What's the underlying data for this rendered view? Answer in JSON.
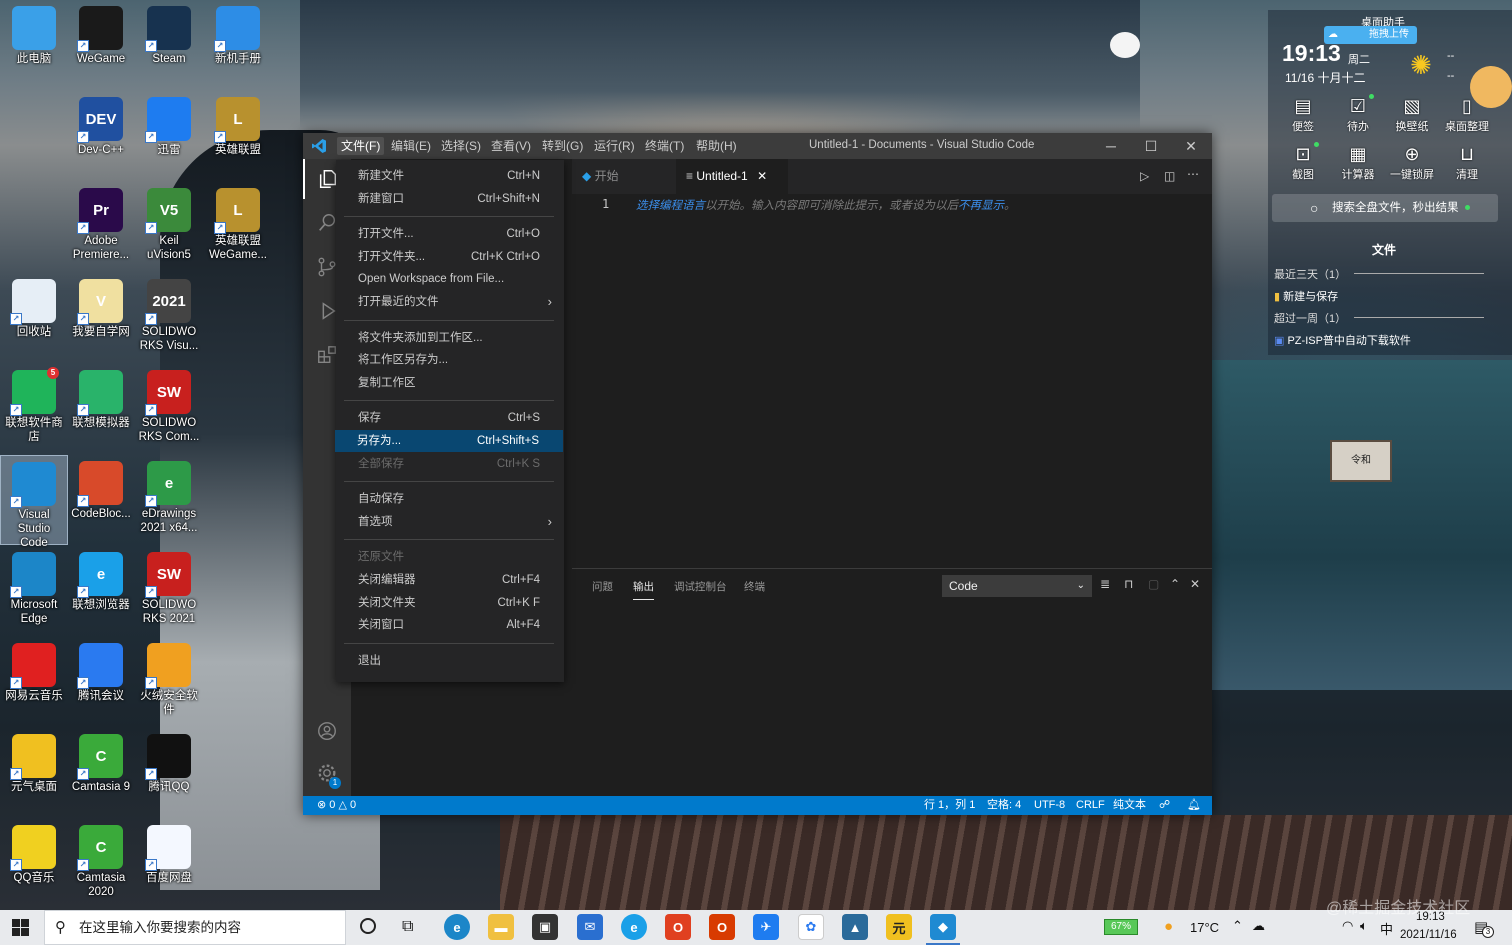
{
  "desktop": {
    "icons": [
      {
        "label": "此电脑",
        "icon": "computer-icon",
        "color": "#3aa0e8"
      },
      {
        "label": "WeGame",
        "icon": "wegame-icon",
        "color": "#1a1a1a"
      },
      {
        "label": "Steam",
        "icon": "steam-icon",
        "color": "#17324f"
      },
      {
        "label": "新机手册",
        "icon": "manual-icon",
        "color": "#2d8de6"
      },
      {
        "label": "Dev-C++",
        "icon": "devcpp-icon",
        "color": "#2050a0",
        "glyph": "DEV"
      },
      {
        "label": "迅雷",
        "icon": "xunlei-icon",
        "color": "#1e7cf0"
      },
      {
        "label": "英雄联盟",
        "icon": "lol-icon",
        "color": "#b8912e",
        "glyph": "L"
      },
      {
        "label": "Adobe\nPremiere...",
        "icon": "premiere-icon",
        "color": "#2a0a4a",
        "glyph": "Pr"
      },
      {
        "label": "Keil\nuVision5",
        "icon": "keil-icon",
        "color": "#3b8a3b",
        "glyph": "V5"
      },
      {
        "label": "英雄联盟\nWeGame...",
        "icon": "lol-wegame-icon",
        "color": "#b8912e",
        "glyph": "L"
      },
      {
        "label": "回收站",
        "icon": "recycle-bin-icon",
        "color": "#e6eef6"
      },
      {
        "label": "我要自学网",
        "icon": "zixue-icon",
        "color": "#f0e0a0",
        "glyph": "V"
      },
      {
        "label": "SOLIDWO\nRKS Visu...",
        "icon": "solidworks-visualize-icon",
        "color": "#444444",
        "glyph": "2021"
      },
      {
        "label": "联想软件商\n店",
        "icon": "lenovo-store-icon",
        "color": "#1fb45a"
      },
      {
        "label": "联想模拟器",
        "icon": "lenovo-emulator-icon",
        "color": "#29b36a"
      },
      {
        "label": "SOLIDWO\nRKS Com...",
        "icon": "solidworks-composer-icon",
        "color": "#c8201e",
        "glyph": "SW"
      },
      {
        "label": "Visual\nStudio\nCode",
        "icon": "vscode-icon",
        "color": "#1f8ad2"
      },
      {
        "label": "CodeBloc...",
        "icon": "codeblocks-icon",
        "color": "#d84a2a"
      },
      {
        "label": "eDrawings\n2021 x64...",
        "icon": "edrawings-icon",
        "color": "#2d9a48",
        "glyph": "e"
      },
      {
        "label": "Microsoft\nEdge",
        "icon": "edge-icon",
        "color": "#1c86c8"
      },
      {
        "label": "联想浏览器",
        "icon": "lenovo-browser-icon",
        "color": "#1aa0e8",
        "glyph": "e"
      },
      {
        "label": "SOLIDWO\nRKS 2021",
        "icon": "solidworks-icon",
        "color": "#c8201e",
        "glyph": "SW"
      },
      {
        "label": "网易云音乐",
        "icon": "netease-music-icon",
        "color": "#e02020"
      },
      {
        "label": "腾讯会议",
        "icon": "tencent-meeting-icon",
        "color": "#2a7af0"
      },
      {
        "label": "火绒安全软\n件",
        "icon": "huorong-icon",
        "color": "#f0a020"
      },
      {
        "label": "元气桌面",
        "icon": "yuanqi-icon",
        "color": "#f0c020"
      },
      {
        "label": "Camtasia 9",
        "icon": "camtasia9-icon",
        "color": "#3aaa3a",
        "glyph": "C"
      },
      {
        "label": "腾讯QQ",
        "icon": "qq-icon",
        "color": "#111111"
      },
      {
        "label": "QQ音乐",
        "icon": "qqmusic-icon",
        "color": "#f0d020"
      },
      {
        "label": "Camtasia\n2020",
        "icon": "camtasia2020-icon",
        "color": "#3aaa3a",
        "glyph": "C"
      },
      {
        "label": "百度网盘",
        "icon": "baidu-netdisk-icon",
        "color": "#f4f8ff"
      }
    ],
    "badge_count": "5",
    "sign_text": "令和"
  },
  "vscode": {
    "window_title": "Untitled-1 - Documents - Visual Studio Code",
    "menubar": [
      "文件(F)",
      "编辑(E)",
      "选择(S)",
      "查看(V)",
      "转到(G)",
      "运行(R)",
      "终端(T)",
      "帮助(H)"
    ],
    "tabs": [
      {
        "label": "开始",
        "active": false
      },
      {
        "label": "Untitled-1",
        "active": true
      }
    ],
    "editor": {
      "line_number": "1",
      "hint_link1": "选择编程语言",
      "hint_mid": "以开始。输入内容即可消除此提示，或者设为以后",
      "hint_link2": "不再显示",
      "hint_end": "。"
    },
    "panel": {
      "tabs": [
        "问题",
        "输出",
        "调试控制台",
        "终端"
      ],
      "active_tab": "输出",
      "select_value": "Code"
    },
    "statusbar": {
      "problems": "0",
      "warnings": "0",
      "position": "行 1，列 1",
      "spaces": "空格: 4",
      "encoding": "UTF-8",
      "eol": "CRLF",
      "language": "纯文本"
    },
    "settings_badge": "1",
    "file_menu": [
      {
        "label": "新建文件",
        "key": "Ctrl+N"
      },
      {
        "label": "新建窗口",
        "key": "Ctrl+Shift+N"
      },
      {
        "sep": true
      },
      {
        "label": "打开文件...",
        "key": "Ctrl+O"
      },
      {
        "label": "打开文件夹...",
        "key": "Ctrl+K Ctrl+O"
      },
      {
        "label": "Open Workspace from File...",
        "key": ""
      },
      {
        "label": "打开最近的文件",
        "key": "",
        "submenu": true
      },
      {
        "sep": true
      },
      {
        "label": "将文件夹添加到工作区...",
        "key": ""
      },
      {
        "label": "将工作区另存为...",
        "key": ""
      },
      {
        "label": "复制工作区",
        "key": ""
      },
      {
        "sep": true
      },
      {
        "label": "保存",
        "key": "Ctrl+S"
      },
      {
        "label": "另存为...",
        "key": "Ctrl+Shift+S",
        "highlight": true
      },
      {
        "label": "全部保存",
        "key": "Ctrl+K S",
        "disabled": true
      },
      {
        "sep": true
      },
      {
        "label": "自动保存",
        "key": ""
      },
      {
        "label": "首选项",
        "key": "",
        "submenu": true
      },
      {
        "sep": true
      },
      {
        "label": "还原文件",
        "key": "",
        "disabled": true
      },
      {
        "label": "关闭编辑器",
        "key": "Ctrl+F4"
      },
      {
        "label": "关闭文件夹",
        "key": "Ctrl+K F"
      },
      {
        "label": "关闭窗口",
        "key": "Alt+F4"
      },
      {
        "sep": true
      },
      {
        "label": "退出",
        "key": ""
      }
    ]
  },
  "widget": {
    "title": "桌面助手",
    "upload_label": "拖拽上传",
    "time": "19:13",
    "weekday": "周二",
    "date": "11/16 十月十二",
    "weather_dash": "--",
    "tools": [
      "便签",
      "待办",
      "换壁纸",
      "桌面整理",
      "截图",
      "计算器",
      "一键锁屏",
      "清理"
    ],
    "search_label": "搜索全盘文件，秒出结果",
    "files_header": "文件",
    "groups": [
      {
        "title": "最近三天（1）",
        "item": "新建与保存"
      },
      {
        "title": "超过一周（1）",
        "item": "PZ-ISP普中自动下载软件"
      }
    ]
  },
  "taskbar": {
    "search_placeholder": "在这里输入你要搜索的内容",
    "battery": "67%",
    "temperature": "17°C",
    "ime": "中",
    "clock_time": "19:13",
    "clock_date": "2021/11/16",
    "notification_count": "3",
    "watermark": "@稀土掘金技术社区"
  },
  "colors": {
    "vscode_blue": "#007acc",
    "menu_highlight": "#094771",
    "titlebar": "#3c3c3c"
  }
}
